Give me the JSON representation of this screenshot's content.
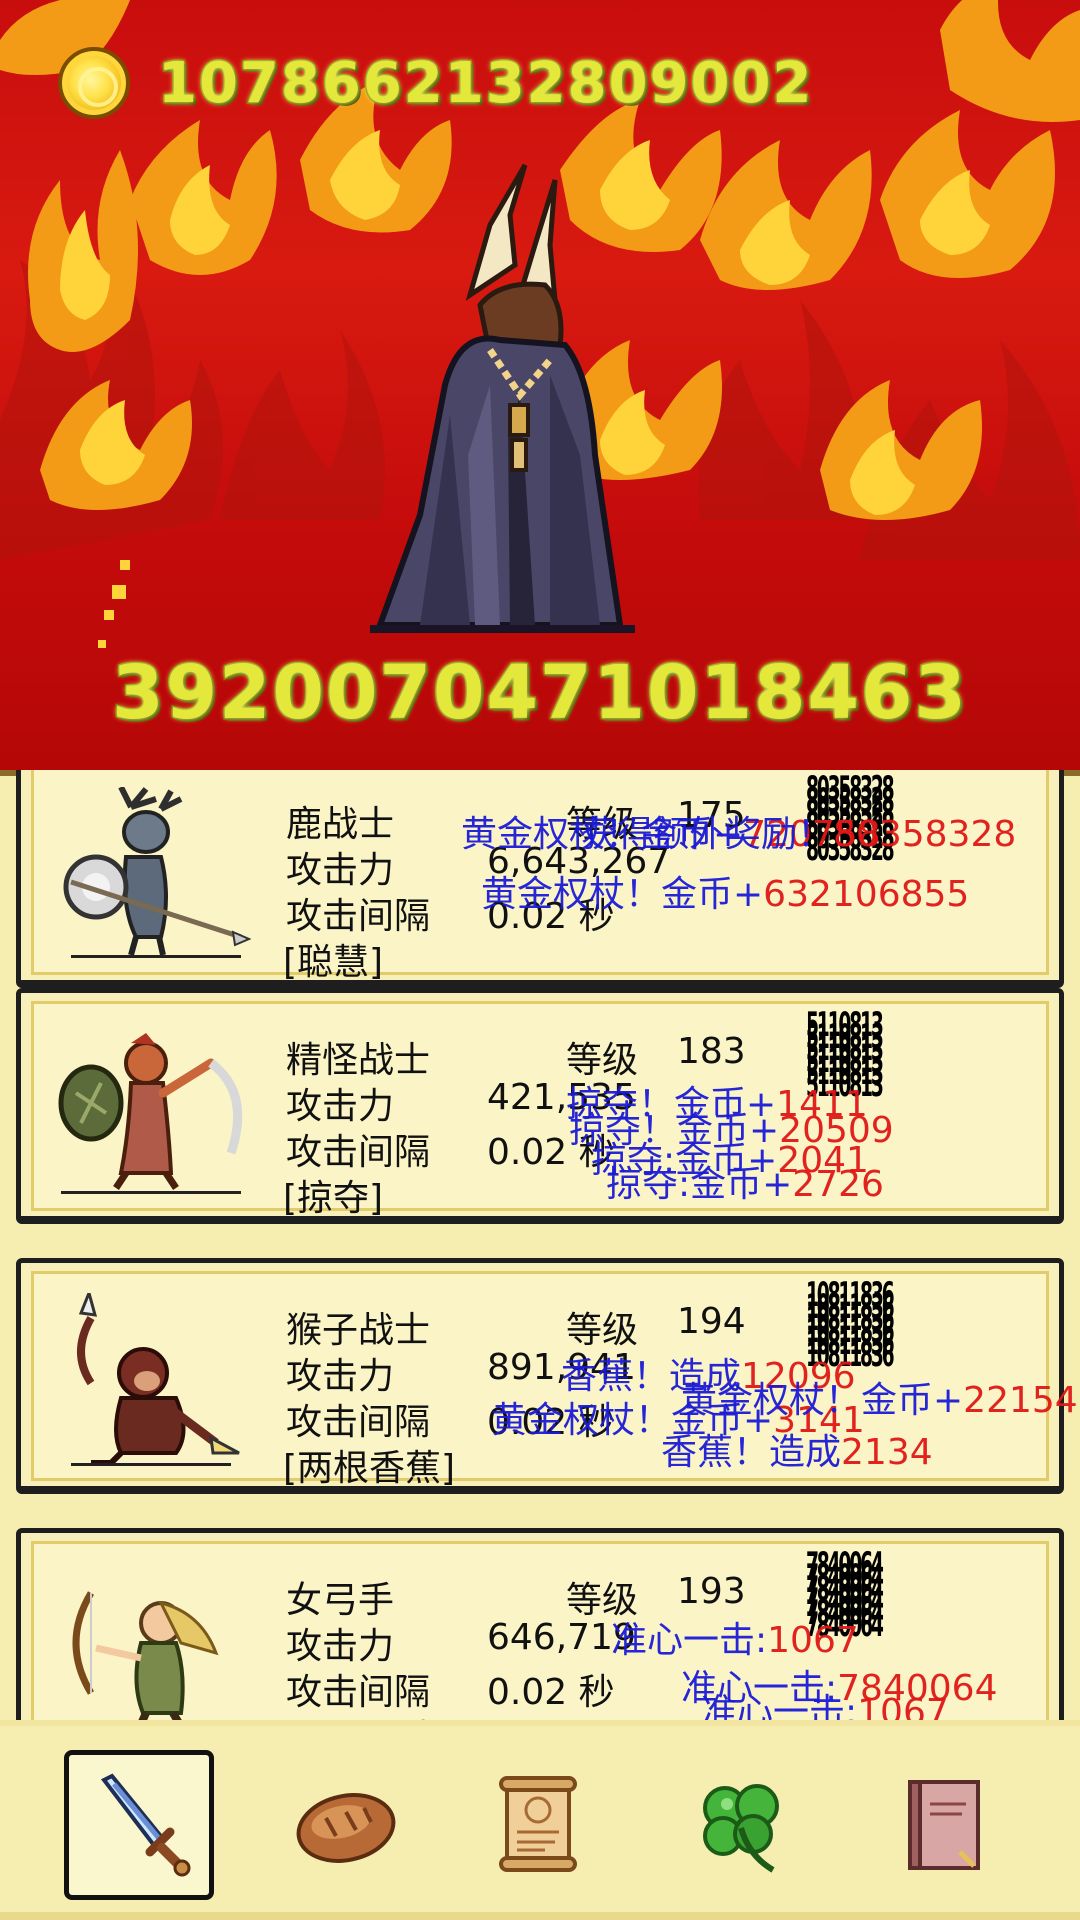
{
  "header": {
    "gold_amount": "1078662132809002",
    "boss_hp": "3920070471018463",
    "coin_icon": "gold-coin-icon",
    "boss_sprite": "horned-cloaked-demon-boss"
  },
  "heroes": [
    {
      "name": "鹿战士",
      "level_label": "等级",
      "level": "175",
      "attack_label": "攻击力",
      "attack": "6,643,267",
      "interval_label": "攻击间隔",
      "interval": "0.02 秒",
      "skill": "[聪慧]",
      "damage": "80358328",
      "sprite": "deer-warrior-sprite",
      "floats": [
        {
          "text": "黄金权杖！金币+",
          "num": "720758"
        },
        {
          "text": "获得额外奖励！",
          "num": "80358328"
        },
        {
          "text": "黄金权杖！金币+",
          "num": "632106855"
        }
      ]
    },
    {
      "name": "精怪战士",
      "level_label": "等级",
      "level": "183",
      "attack_label": "攻击力",
      "attack": "421,535",
      "interval_label": "攻击间隔",
      "interval": "0.02 秒",
      "skill": "[掠夺]",
      "damage": "5110813",
      "sprite": "goblin-warrior-sprite",
      "floats": [
        {
          "text": "掠夺！金币+",
          "num": "1411"
        },
        {
          "text": "掠夺！金币+",
          "num": "20509"
        },
        {
          "text": "掠夺:金币+",
          "num": "2041"
        },
        {
          "text": "掠夺:金币+",
          "num": "2726"
        }
      ]
    },
    {
      "name": "猴子战士",
      "level_label": "等级",
      "level": "194",
      "attack_label": "攻击力",
      "attack": "891,941",
      "interval_label": "攻击间隔",
      "interval": "0.02 秒",
      "skill": "[两根香蕉]",
      "damage": "10811836",
      "sprite": "monkey-warrior-sprite",
      "floats": [
        {
          "text": "香蕉！造成",
          "num": "12096"
        },
        {
          "text": "黄金权杖！金币+",
          "num": "3141"
        },
        {
          "text": "黄金权杖！金币+",
          "num": "22154"
        },
        {
          "text": "香蕉！造成",
          "num": "2134"
        }
      ]
    },
    {
      "name": "女弓手",
      "level_label": "等级",
      "level": "193",
      "attack_label": "攻击力",
      "attack": "646,719",
      "interval_label": "攻击间隔",
      "interval": "0.02 秒",
      "skill": "[准心一击]",
      "damage": "7840064",
      "sprite": "female-archer-sprite",
      "floats": [
        {
          "text": "准心一击:",
          "num": "1067"
        },
        {
          "text": "准心一击:",
          "num": "7840064"
        },
        {
          "text": "准心一击:",
          "num": "1067"
        }
      ]
    }
  ],
  "menu": [
    {
      "name": "sword-icon",
      "active": true
    },
    {
      "name": "bread-icon",
      "active": false
    },
    {
      "name": "scroll-icon",
      "active": false
    },
    {
      "name": "clover-icon",
      "active": false
    },
    {
      "name": "book-icon",
      "active": false
    }
  ],
  "colors": {
    "scene_red": "#c80d0d",
    "flame_orange": "#f39a16",
    "flame_yellow": "#ffd33a",
    "gold_text": "#e4e83a",
    "panel_bg": "#f6eeb0",
    "float_blue": "#1b1bd8",
    "float_red": "#e01818"
  }
}
